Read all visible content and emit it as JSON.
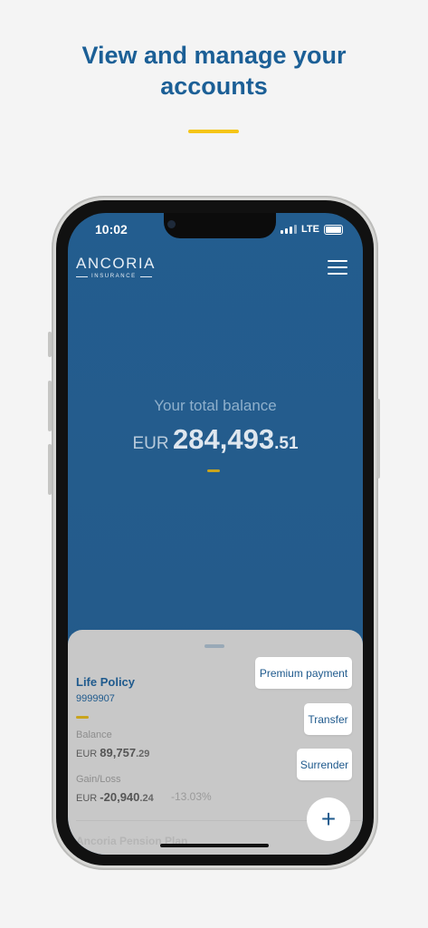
{
  "headline": {
    "line1": "View and manage your",
    "line2": "accounts"
  },
  "status_bar": {
    "time": "10:02",
    "network": "LTE"
  },
  "app": {
    "logo_main": "ANCORIA",
    "logo_sub": "INSURANCE"
  },
  "balance": {
    "label": "Your total balance",
    "currency": "EUR",
    "integer": "284,493",
    "decimal": ".51"
  },
  "policy": {
    "title": "Life Policy",
    "number": "9999907",
    "balance_label": "Balance",
    "balance_currency": "EUR",
    "balance_int": "89,757",
    "balance_dec": ".29",
    "gain_label": "Gain/Loss",
    "gain_currency": "EUR",
    "gain_int": "-20,940",
    "gain_dec": ".24",
    "gain_pct": "-13.03%"
  },
  "actions": {
    "premium": "Premium payment",
    "transfer": "Transfer",
    "surrender": "Surrender"
  },
  "next_item": "Ancoria Pension Plan",
  "fab_label": "+",
  "colors": {
    "brand_blue": "#1f5a8d",
    "accent_yellow": "#f5c518"
  }
}
